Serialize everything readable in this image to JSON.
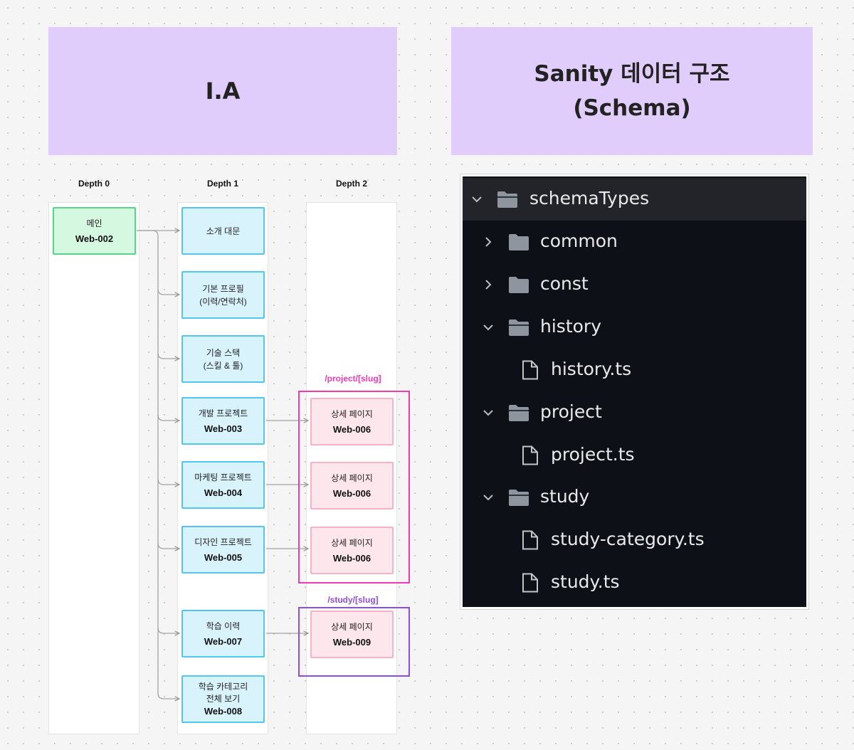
{
  "ia_title": "I.A",
  "schema_title_line1": "Sanity 데이터 구조",
  "schema_title_line2": "(Schema)",
  "depths": [
    "Depth 0",
    "Depth 1",
    "Depth 2"
  ],
  "nodes": {
    "main": {
      "label": "메인",
      "code": "Web-002"
    },
    "intro": {
      "label": "소개 대문"
    },
    "profile": {
      "label": "기본 프로필",
      "label2": "(이력/연락처)"
    },
    "stack": {
      "label": "기술 스택",
      "label2": "(스킬 & 툴)"
    },
    "dev": {
      "label": "개발 프로젝트",
      "code": "Web-003"
    },
    "marketing": {
      "label": "마케팅 프로젝트",
      "code": "Web-004"
    },
    "design": {
      "label": "디자인 프로젝트",
      "code": "Web-005"
    },
    "study": {
      "label": "학습 이력",
      "code": "Web-007"
    },
    "category": {
      "label": "학습 카테고리",
      "label2": "전체 보기",
      "code": "Web-008"
    },
    "detail_dev": {
      "label": "상세 페이지",
      "code": "Web-006"
    },
    "detail_marketing": {
      "label": "상세 페이지",
      "code": "Web-006"
    },
    "detail_design": {
      "label": "상세 페이지",
      "code": "Web-006"
    },
    "detail_study": {
      "label": "상세 페이지",
      "code": "Web-009"
    }
  },
  "routes": {
    "project": "/project/[slug]",
    "study": "/study/[slug]"
  },
  "colors": {
    "project_route": "#ee3bb0",
    "study_route": "#8a4de8"
  },
  "tree": [
    {
      "label": "schemaTypes",
      "kind": "folder",
      "expanded": true
    },
    {
      "label": "common",
      "kind": "folder",
      "expanded": false
    },
    {
      "label": "const",
      "kind": "folder",
      "expanded": false
    },
    {
      "label": "history",
      "kind": "folder",
      "expanded": true
    },
    {
      "label": "history.ts",
      "kind": "file"
    },
    {
      "label": "project",
      "kind": "folder",
      "expanded": true
    },
    {
      "label": "project.ts",
      "kind": "file"
    },
    {
      "label": "study",
      "kind": "folder",
      "expanded": true
    },
    {
      "label": "study-category.ts",
      "kind": "file"
    },
    {
      "label": "study.ts",
      "kind": "file"
    }
  ]
}
